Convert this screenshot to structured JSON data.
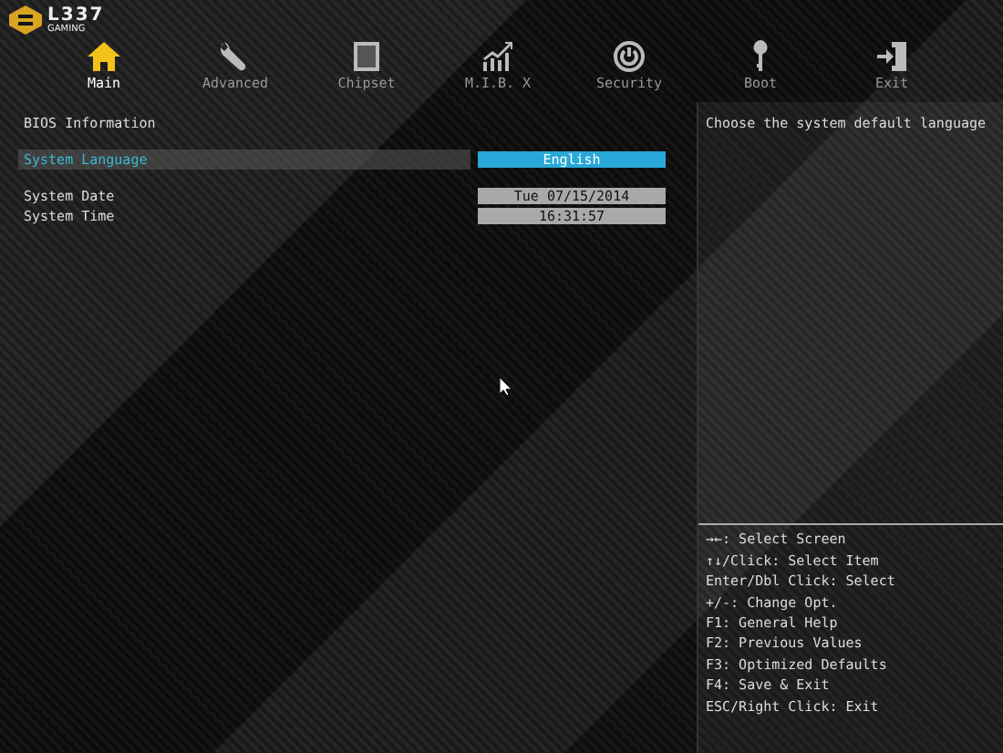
{
  "logo": {
    "title": "L337",
    "subtitle": "GAMING"
  },
  "tabs": [
    {
      "label": "Main",
      "selected": true
    },
    {
      "label": "Advanced",
      "selected": false
    },
    {
      "label": "Chipset",
      "selected": false
    },
    {
      "label": "M.I.B. X",
      "selected": false
    },
    {
      "label": "Security",
      "selected": false
    },
    {
      "label": "Boot",
      "selected": false
    },
    {
      "label": "Exit",
      "selected": false
    }
  ],
  "groups": [
    [
      {
        "kind": "heading",
        "label": "BIOS Information"
      }
    ],
    [
      {
        "kind": "setting",
        "label": "System Language",
        "value": "English",
        "selected": true
      }
    ],
    [
      {
        "kind": "setting",
        "label": "System Date",
        "value": "Tue 07/15/2014",
        "selected": false
      },
      {
        "kind": "setting",
        "label": "System Time",
        "value": "16:31:57",
        "selected": false
      }
    ]
  ],
  "help": {
    "description": "Choose the system default language",
    "keys": [
      "→←: Select Screen",
      "↑↓/Click: Select Item",
      "Enter/Dbl Click: Select",
      "+/-: Change Opt.",
      "F1: General Help",
      "F2: Previous Values",
      "F3: Optimized Defaults",
      "F4: Save & Exit",
      "ESC/Right Click: Exit"
    ]
  }
}
